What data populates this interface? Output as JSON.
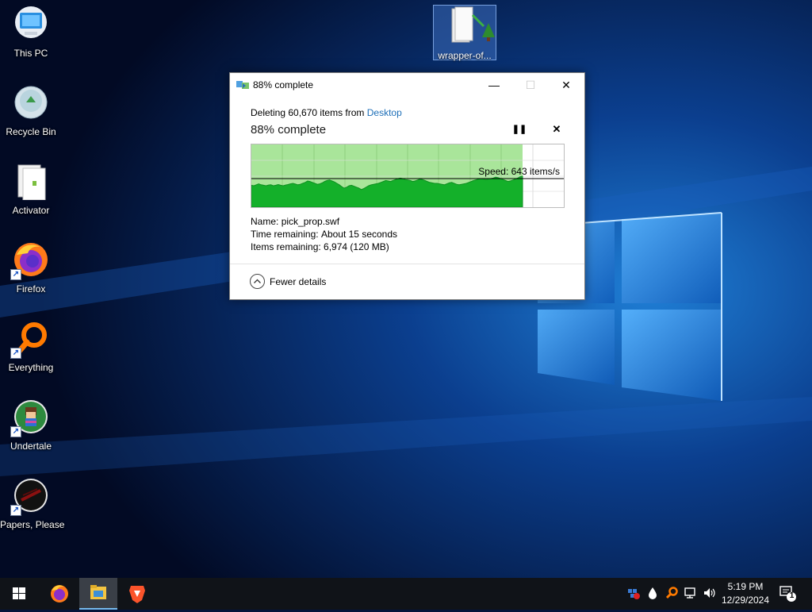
{
  "desktop": {
    "icons": [
      {
        "label": "This PC",
        "icon": "computer-icon"
      },
      {
        "label": "Recycle Bin",
        "icon": "recycle-bin-icon"
      },
      {
        "label": "Activator",
        "icon": "document-icon"
      },
      {
        "label": "Firefox",
        "icon": "firefox-icon"
      },
      {
        "label": "Everything",
        "icon": "search-magnifier-icon"
      },
      {
        "label": "Undertale",
        "icon": "undertale-icon"
      },
      {
        "label": "Papers, Please",
        "icon": "papers-please-icon"
      }
    ],
    "selected_item": {
      "label": "wrapper-of...",
      "icon": "folder-icon"
    }
  },
  "dialog": {
    "title": "88% complete",
    "deleting_prefix": "Deleting 60,670 items from ",
    "destination": "Desktop",
    "heading": "88% complete",
    "pause_glyph": "❚❚",
    "cancel_glyph": "✕",
    "speed_label": "Speed: 643 items/s",
    "progress_fraction": 0.88,
    "details": {
      "name_label": "Name:",
      "name_value": "pick_prop.swf",
      "time_label": "Time remaining:",
      "time_value": "About 15 seconds",
      "items_label": "Items remaining:",
      "items_value": "6,974 (120 MB)"
    },
    "fewer_details": "Fewer details",
    "window_buttons": {
      "minimize": "—",
      "maximize": "☐",
      "close": "✕"
    }
  },
  "chart_data": {
    "type": "area",
    "title": "",
    "speed_current": 643,
    "unit": "items/s",
    "speed_series": [
      0.28,
      0.3,
      0.26,
      0.22,
      0.26,
      0.28,
      0.3,
      0.27,
      0.26,
      0.3,
      0.28,
      0.25,
      0.28,
      0.3,
      0.27,
      0.25,
      0.22,
      0.2,
      0.23,
      0.26,
      0.24,
      0.2,
      0.16,
      0.1,
      0.12,
      0.16,
      0.2,
      0.24,
      0.22,
      0.18,
      0.12,
      0.08,
      0.06,
      0.1,
      0.14,
      0.2,
      0.26,
      0.34,
      0.4,
      0.36,
      0.3,
      0.28,
      0.32,
      0.36,
      0.4,
      0.46,
      0.42,
      0.36,
      0.3,
      0.26,
      0.24,
      0.22,
      0.2,
      0.16,
      0.12,
      0.08,
      0.1,
      0.12,
      0.08,
      0.04,
      0.0,
      -0.02,
      0.0,
      0.04,
      0.06,
      0.08,
      0.12,
      0.1,
      0.06,
      0.02,
      0.04,
      0.08,
      0.12,
      0.16,
      0.18,
      0.2,
      0.2,
      0.22,
      0.24,
      0.26,
      0.22,
      0.18,
      0.16,
      0.2,
      0.24,
      0.26,
      0.24,
      0.22,
      0.2,
      0.16,
      0.12,
      0.08,
      0.05,
      0.02,
      0.0,
      0.02,
      0.04,
      0.02,
      0.0,
      -0.02,
      -0.06,
      -0.04,
      0.0,
      0.04,
      0.08,
      0.12,
      0.1,
      0.06,
      0.02,
      -0.02,
      -0.08,
      -0.1
    ]
  },
  "taskbar": {
    "apps": [
      "start-icon",
      "firefox-icon",
      "file-explorer-icon",
      "brave-icon"
    ],
    "clock_time": "5:19 PM",
    "clock_date": "12/29/2024",
    "notification_count": "1"
  }
}
